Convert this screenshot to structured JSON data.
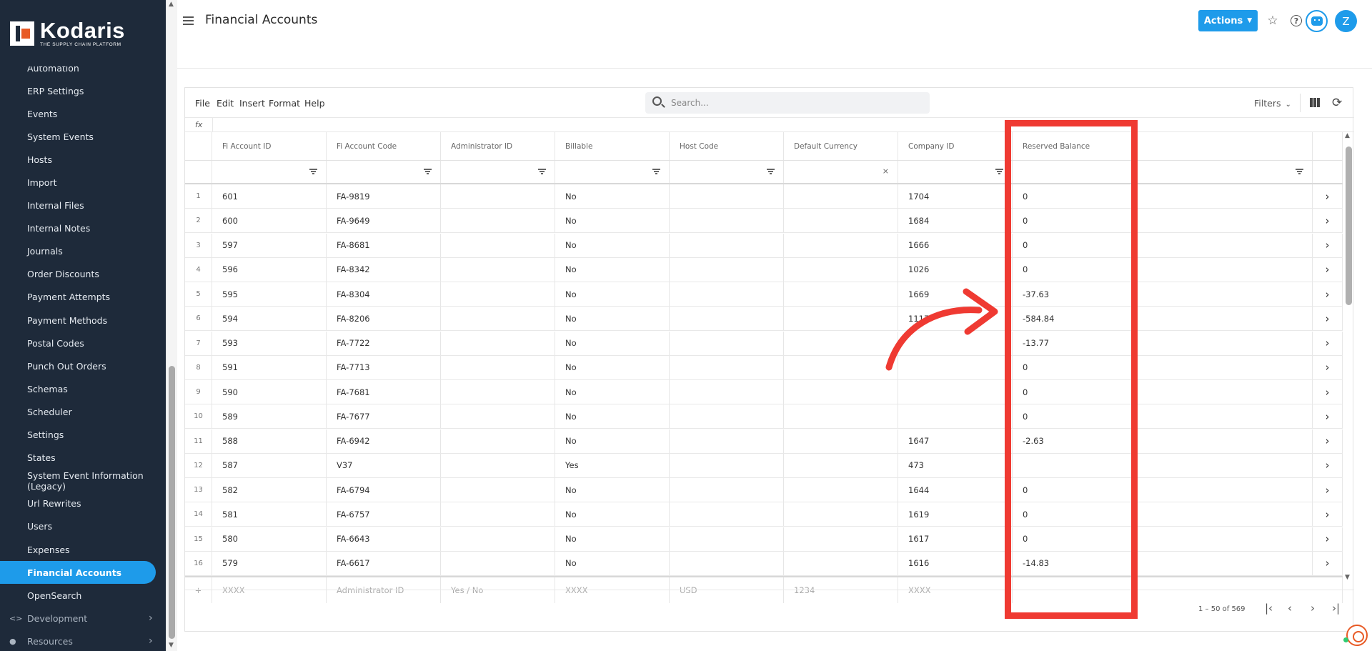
{
  "app": {
    "logo_name": "Kodaris",
    "logo_tagline": "THE SUPPLY CHAIN PLATFORM"
  },
  "sidebar": {
    "partial_item": "Automation",
    "items": [
      {
        "label": "ERP Settings"
      },
      {
        "label": "Events"
      },
      {
        "label": "System Events"
      },
      {
        "label": "Hosts"
      },
      {
        "label": "Import"
      },
      {
        "label": "Internal Files"
      },
      {
        "label": "Internal Notes"
      },
      {
        "label": "Journals"
      },
      {
        "label": "Order Discounts"
      },
      {
        "label": "Payment Attempts"
      },
      {
        "label": "Payment Methods"
      },
      {
        "label": "Postal Codes"
      },
      {
        "label": "Punch Out Orders"
      },
      {
        "label": "Schemas"
      },
      {
        "label": "Scheduler"
      },
      {
        "label": "Settings"
      },
      {
        "label": "States"
      },
      {
        "label": "System Event Information (Legacy)"
      },
      {
        "label": "Url Rewrites"
      },
      {
        "label": "Users"
      },
      {
        "label": "Expenses"
      },
      {
        "label": "Financial Accounts"
      },
      {
        "label": "OpenSearch"
      }
    ],
    "active_index": 21,
    "groups": [
      {
        "label": "Development",
        "icon": "code-icon"
      },
      {
        "label": "Resources",
        "icon": "help-circle-icon"
      }
    ]
  },
  "header": {
    "title": "Financial Accounts",
    "actions_label": "Actions",
    "avatar_initial": "Z",
    "accent_color": "#1e9bea"
  },
  "toolbar": {
    "menus": [
      "File",
      "Edit",
      "Insert",
      "Format",
      "Help"
    ],
    "search_placeholder": "Search...",
    "filters_label": "Filters"
  },
  "formula_bar": {
    "label": "fx"
  },
  "table": {
    "columns": [
      "Fi Account ID",
      "Fi Account Code",
      "Administrator ID",
      "Billable",
      "Host Code",
      "Default Currency",
      "Company ID",
      "Reserved Balance"
    ],
    "rows": [
      {
        "num": "1",
        "cells": [
          "601",
          "FA-9819",
          "",
          "No",
          "",
          "",
          "1704",
          "0"
        ]
      },
      {
        "num": "2",
        "cells": [
          "600",
          "FA-9649",
          "",
          "No",
          "",
          "",
          "1684",
          "0"
        ]
      },
      {
        "num": "3",
        "cells": [
          "597",
          "FA-8681",
          "",
          "No",
          "",
          "",
          "1666",
          "0"
        ]
      },
      {
        "num": "4",
        "cells": [
          "596",
          "FA-8342",
          "",
          "No",
          "",
          "",
          "1026",
          "0"
        ]
      },
      {
        "num": "5",
        "cells": [
          "595",
          "FA-8304",
          "",
          "No",
          "",
          "",
          "1669",
          "-37.63"
        ]
      },
      {
        "num": "6",
        "cells": [
          "594",
          "FA-8206",
          "",
          "No",
          "",
          "",
          "1117",
          "-584.84"
        ]
      },
      {
        "num": "7",
        "cells": [
          "593",
          "FA-7722",
          "",
          "No",
          "",
          "",
          "",
          "-13.77"
        ]
      },
      {
        "num": "8",
        "cells": [
          "591",
          "FA-7713",
          "",
          "No",
          "",
          "",
          "",
          "0"
        ]
      },
      {
        "num": "9",
        "cells": [
          "590",
          "FA-7681",
          "",
          "No",
          "",
          "",
          "",
          "0"
        ]
      },
      {
        "num": "10",
        "cells": [
          "589",
          "FA-7677",
          "",
          "No",
          "",
          "",
          "",
          "0"
        ]
      },
      {
        "num": "11",
        "cells": [
          "588",
          "FA-6942",
          "",
          "No",
          "",
          "",
          "1647",
          "-2.63"
        ]
      },
      {
        "num": "12",
        "cells": [
          "587",
          "V37",
          "",
          "Yes",
          "",
          "",
          "473",
          ""
        ]
      },
      {
        "num": "13",
        "cells": [
          "582",
          "FA-6794",
          "",
          "No",
          "",
          "",
          "1644",
          "0"
        ]
      },
      {
        "num": "14",
        "cells": [
          "581",
          "FA-6757",
          "",
          "No",
          "",
          "",
          "1619",
          "0"
        ]
      },
      {
        "num": "15",
        "cells": [
          "580",
          "FA-6643",
          "",
          "No",
          "",
          "",
          "1617",
          "0"
        ]
      },
      {
        "num": "16",
        "cells": [
          "579",
          "FA-6617",
          "",
          "No",
          "",
          "",
          "1616",
          "-14.83"
        ]
      }
    ],
    "new_row_placeholders": [
      "",
      "XXXX",
      "Administrator ID",
      "Yes / No",
      "XXXX",
      "USD",
      "1234",
      "XXXX"
    ]
  },
  "pager": {
    "range_text": "1 – 50 of 569"
  },
  "annotation": {
    "highlight_color": "#ef3a32"
  }
}
